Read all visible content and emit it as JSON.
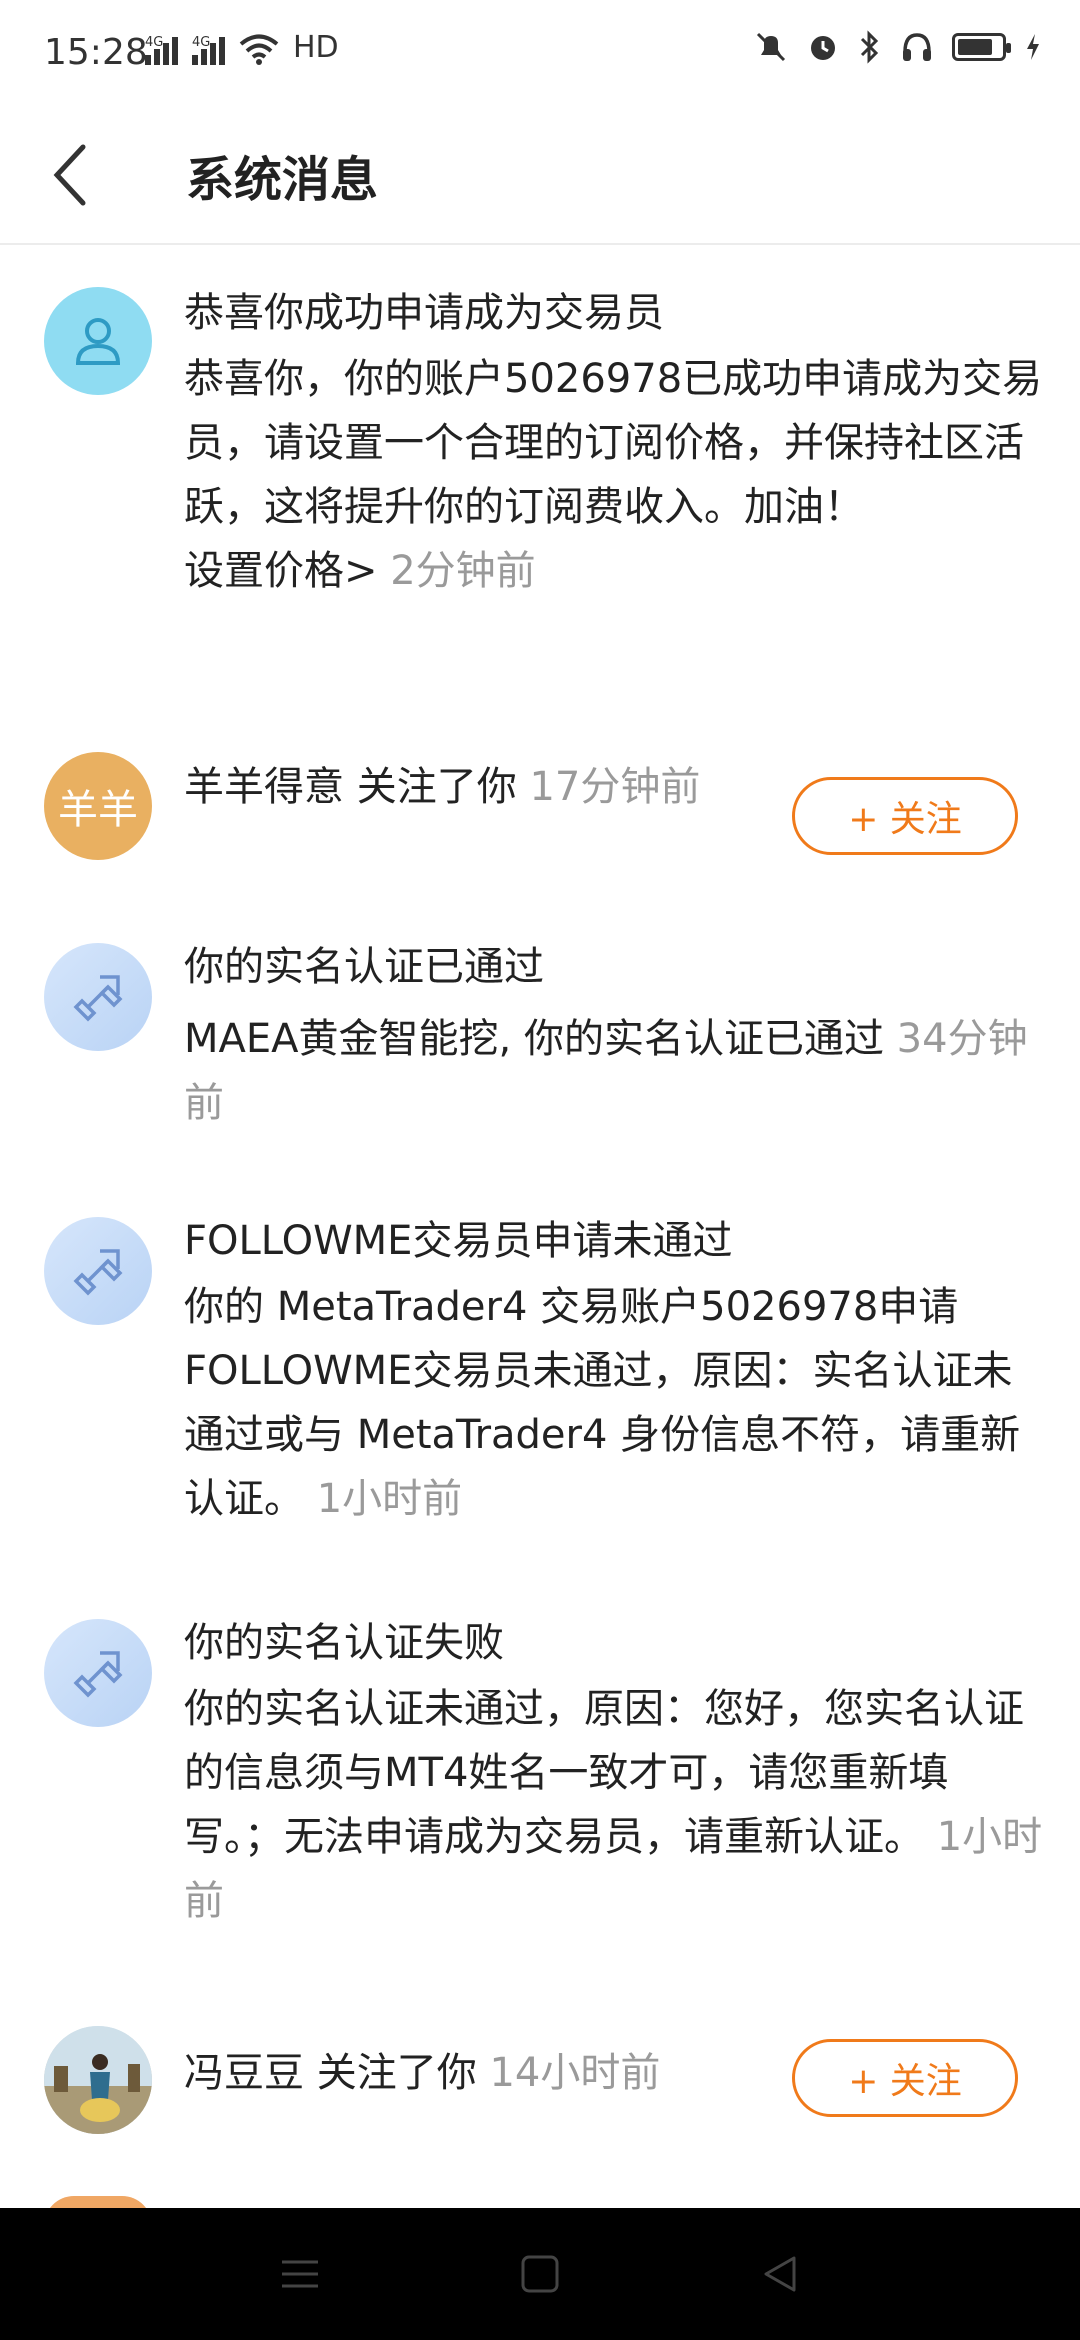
{
  "status_bar": {
    "time": "15:28",
    "network_1": "4G",
    "network_2": "4G",
    "hd_label": "HD",
    "battery_level": 0.8,
    "icons": [
      "signal-icon",
      "wifi-icon",
      "mute-icon",
      "alarm-icon",
      "bluetooth-icon",
      "headphones-icon",
      "battery-icon",
      "charging-icon"
    ]
  },
  "header": {
    "title": "系统消息",
    "back_icon": "chevron-left-icon"
  },
  "messages": [
    {
      "avatar": "user-icon",
      "title": "恭喜你成功申请成为交易员",
      "body": "恭喜你，你的账户5026978已成功申请成为交易员，请设置一个合理的订阅价格，并保持社区活跃，这将提升你的订阅费收入。加油！",
      "link": "设置价格>",
      "time": "2分钟前"
    },
    {
      "avatar_text": "羊羊",
      "text": "羊羊得意 关注了你",
      "time": "17分钟前",
      "button": "+ 关注"
    },
    {
      "avatar": "link-arrows-icon",
      "title": "你的实名认证已通过",
      "body": "MAEA黄金智能挖, 你的实名认证已通过",
      "time": "34分钟前"
    },
    {
      "avatar": "link-arrows-icon",
      "title": "FOLLOWME交易员申请未通过",
      "body": "你的 MetaTrader4 交易账户5026978申请FOLLOWME交易员未通过，原因：实名认证未通过或与 MetaTrader4 身份信息不符，请重新认证。",
      "time": "1小时前"
    },
    {
      "avatar": "link-arrows-icon",
      "title": "你的实名认证失败",
      "body": "你的实名认证未通过，原因：您好，您实名认证的信息须与MT4姓名一致才可，请您重新填写。；无法申请成为交易员，请重新认证。",
      "time": "1小时前"
    },
    {
      "avatar": "photo-avatar",
      "text": "冯豆豆 关注了你",
      "time": "14小时前",
      "button": "+ 关注"
    }
  ],
  "colors": {
    "accent": "#f07a1a",
    "muted_text": "#9a9a9a",
    "avatar_user": "#8fdcf2",
    "avatar_text": "#e9b061"
  }
}
